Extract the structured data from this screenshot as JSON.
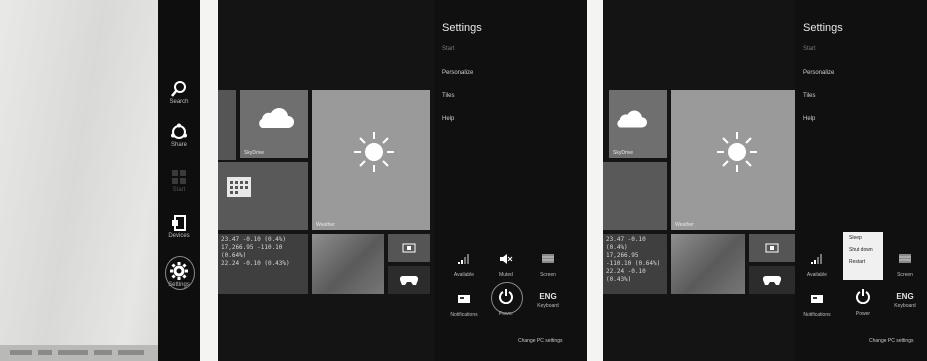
{
  "charms": {
    "search_label": "Search",
    "share_label": "Share",
    "start_label": "Start",
    "devices_label": "Devices",
    "settings_label": "Settings"
  },
  "panel2": {
    "settings_title": "Settings",
    "menu_items": [
      "Start",
      "Personalize",
      "Tiles",
      "Help"
    ],
    "tiles": {
      "skydrive_label": "SkyDrive",
      "weather_label": "Weather",
      "stock_lines": [
        "23.47 -0.10 (0.4%)",
        "17,266.95 -110.10 (0.64%)",
        "22.24 -0.10 (0.43%)"
      ]
    },
    "quick": {
      "network_label": "Available",
      "volume_label": "Muted",
      "screen_label": "Screen",
      "notifications_label": "Notifications",
      "power_label": "Power",
      "keyboard_label": "Keyboard",
      "keyboard_text": "ENG"
    },
    "change_pc_settings": "Change PC settings"
  },
  "panel3": {
    "settings_title": "Settings",
    "menu_items": [
      "Start",
      "Personalize",
      "Tiles",
      "Help"
    ],
    "tiles": {
      "skydrive_label": "SkyDrive",
      "weather_label": "Weather",
      "stock_lines": [
        "23.47 -0.10 (0.4%)",
        "17,266.95 -110.10 (0.64%)",
        "22.24 -0.10 (0.43%)"
      ]
    },
    "power_menu": [
      "Sleep",
      "Shut down",
      "Restart"
    ],
    "quick": {
      "network_label": "Available",
      "screen_label": "Screen",
      "notifications_label": "Notifications",
      "power_label": "Power",
      "keyboard_label": "Keyboard",
      "keyboard_text": "ENG"
    },
    "change_pc_settings": "Change PC settings"
  },
  "colors": {
    "charm_bar": "#0e0e0e",
    "settings_pane": "#101010",
    "start_bg": "#141414"
  }
}
